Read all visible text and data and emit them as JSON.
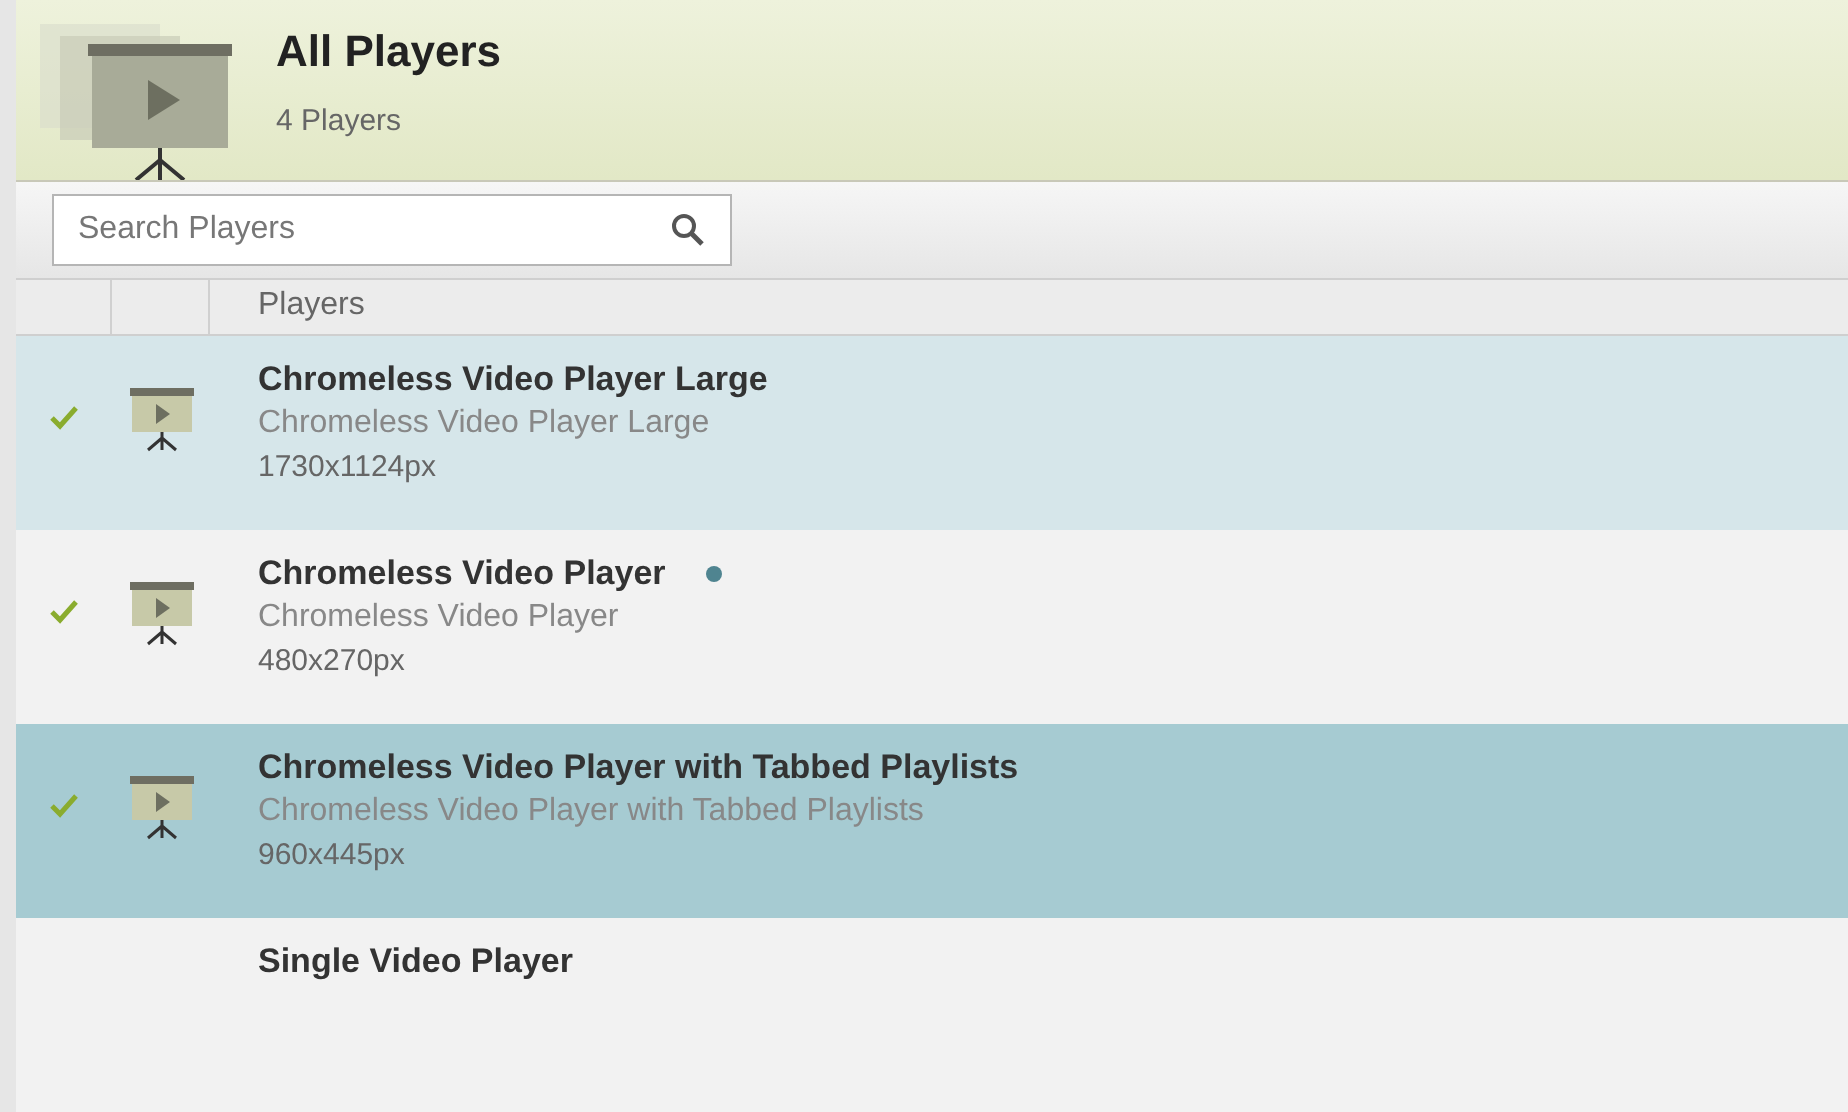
{
  "header": {
    "title": "All Players",
    "subtitle": "4 Players"
  },
  "search": {
    "placeholder": "Search Players"
  },
  "table": {
    "columns": [
      "Players"
    ],
    "rows": [
      {
        "title": "Chromeless Video Player Large",
        "description": "Chromeless Video Player Large",
        "size": "1730x1124px",
        "checked": true,
        "selected": false,
        "hovered": true,
        "marked": false
      },
      {
        "title": "Chromeless Video Player",
        "description": "Chromeless Video Player",
        "size": "480x270px",
        "checked": true,
        "selected": false,
        "hovered": false,
        "marked": true
      },
      {
        "title": "Chromeless Video Player with Tabbed Playlists",
        "description": "Chromeless Video Player with Tabbed Playlists",
        "size": "960x445px",
        "checked": true,
        "selected": true,
        "marked": false
      },
      {
        "title": "Single Video Player",
        "selected": false,
        "hovered": false
      }
    ]
  }
}
